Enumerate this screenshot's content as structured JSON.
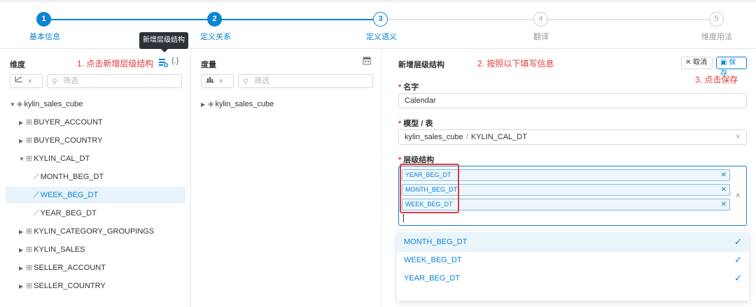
{
  "stepper": {
    "steps": [
      {
        "num": "1",
        "label": "基本信息"
      },
      {
        "num": "2",
        "label": "定义关系"
      },
      {
        "num": "3",
        "label": "定义语义"
      },
      {
        "num": "4",
        "label": "翻译"
      },
      {
        "num": "5",
        "label": "维度用法"
      }
    ]
  },
  "tooltip": {
    "text": "新增层级结构"
  },
  "left_panel": {
    "title": "维度",
    "annotation": "1. 点击新增层级结构",
    "filter_placeholder": "筛选",
    "tree": [
      {
        "label": "kylin_sales_cube"
      },
      {
        "label": "BUYER_ACCOUNT"
      },
      {
        "label": "BUYER_COUNTRY"
      },
      {
        "label": "KYLIN_CAL_DT"
      },
      {
        "label": "MONTH_BEG_DT"
      },
      {
        "label": "WEEK_BEG_DT"
      },
      {
        "label": "YEAR_BEG_DT"
      },
      {
        "label": "KYLIN_CATEGORY_GROUPINGS"
      },
      {
        "label": "KYLIN_SALES"
      },
      {
        "label": "SELLER_ACCOUNT"
      },
      {
        "label": "SELLER_COUNTRY"
      }
    ]
  },
  "mid_panel": {
    "title": "度量",
    "filter_placeholder": "筛选",
    "tree": [
      {
        "label": "kylin_sales_cube"
      }
    ]
  },
  "right_panel": {
    "title": "新增层级结构",
    "annotation_fill": "2. 按照以下填写信息",
    "annotation_save": "3. 点击保存",
    "cancel_label": "取消",
    "save_label": "保存",
    "name_label": "名字",
    "name_value": "Calendar",
    "model_label": "模型 / 表",
    "model_value_cube": "kylin_sales_cube",
    "model_separator": "/",
    "model_value_table": "KYLIN_CAL_DT",
    "hierarchy_label": "层级结构",
    "tags": [
      "YEAR_BEG_DT",
      "MONTH_BEG_DT",
      "WEEK_BEG_DT"
    ],
    "dropdown": [
      "MONTH_BEG_DT",
      "WEEK_BEG_DT",
      "YEAR_BEG_DT"
    ]
  },
  "colors": {
    "accent": "#0a84d6",
    "annotation": "#e03a3a"
  }
}
